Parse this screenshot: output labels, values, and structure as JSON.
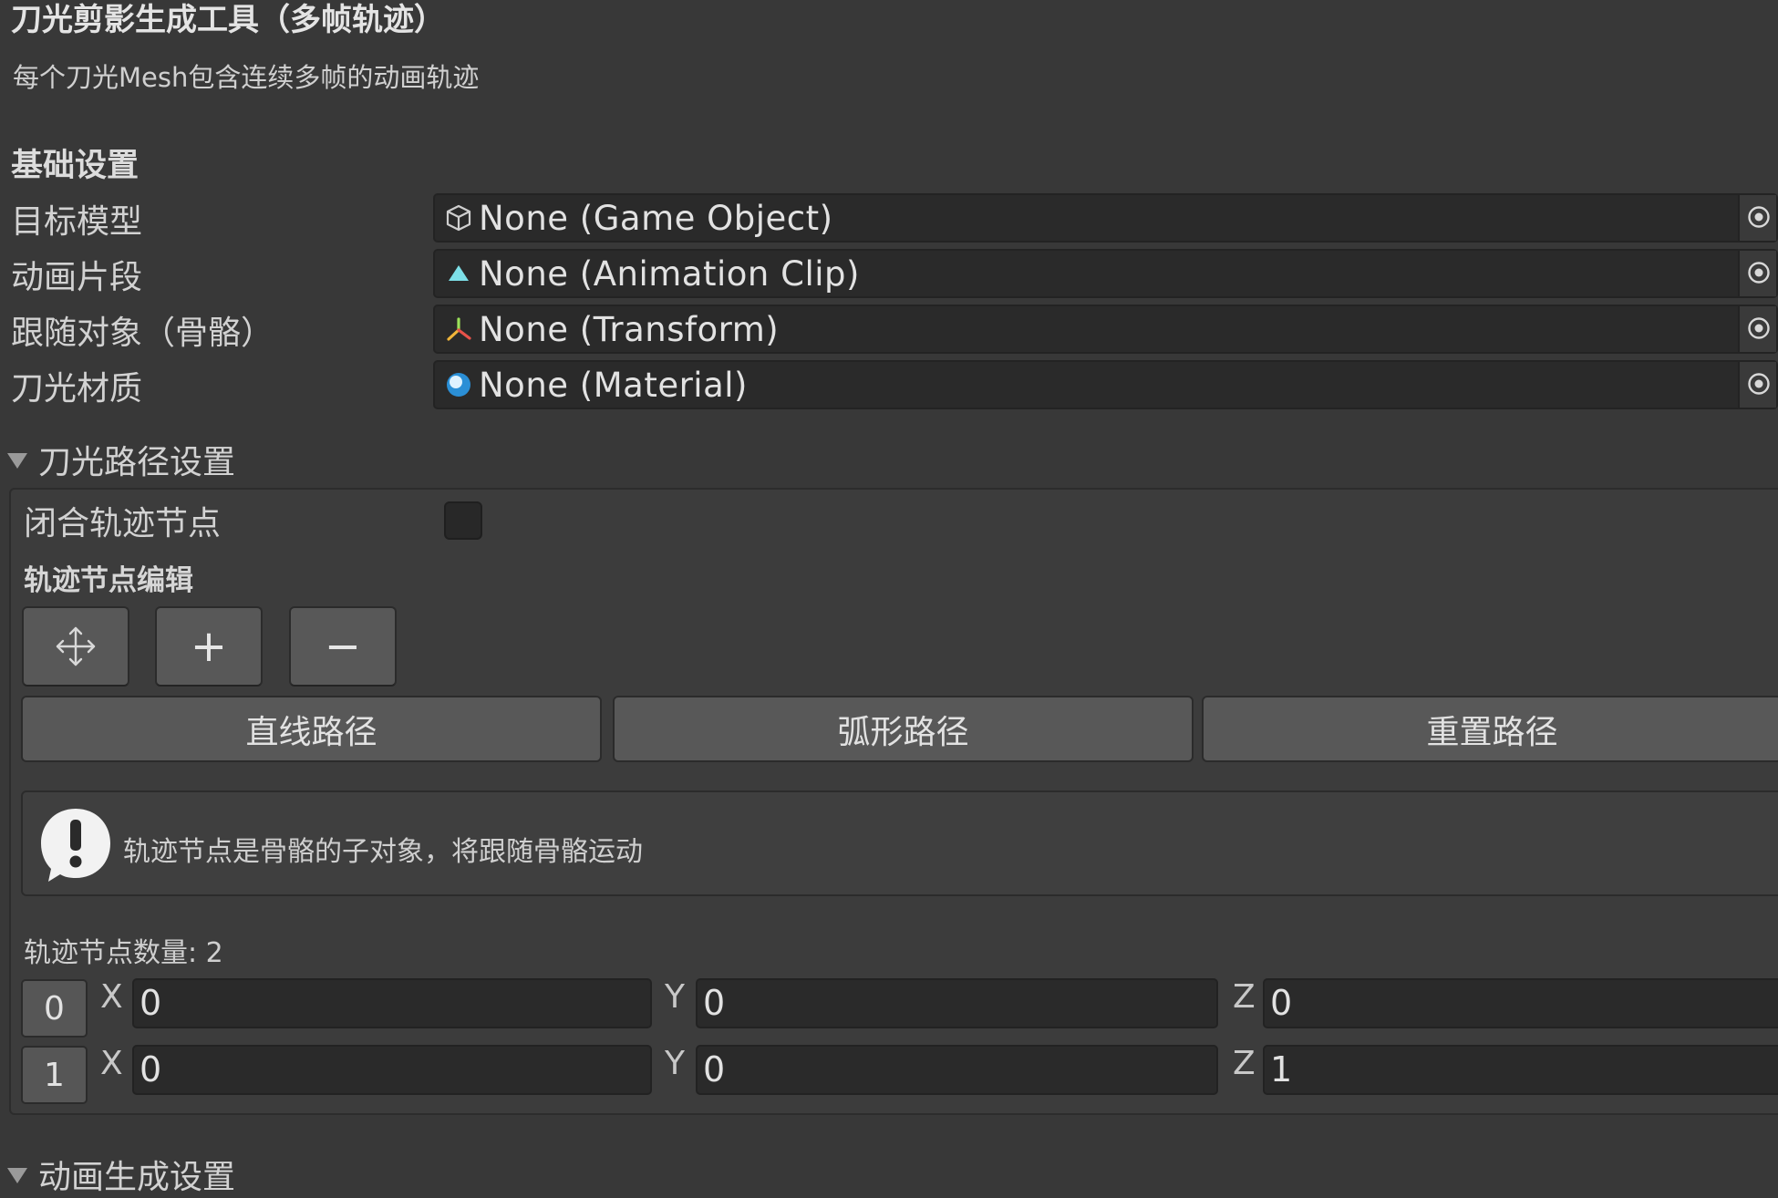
{
  "header": {
    "title": "刀光剪影生成工具（多帧轨迹）",
    "subtitle": "每个刀光Mesh包含连续多帧的动画轨迹"
  },
  "basic_settings": {
    "heading": "基础设置",
    "fields": [
      {
        "label": "目标模型",
        "value": "None (Game Object)",
        "icon": "gameobject-cube-icon"
      },
      {
        "label": "动画片段",
        "value": "None (Animation Clip)",
        "icon": "animation-clip-icon"
      },
      {
        "label": "跟随对象（骨骼）",
        "value": "None (Transform)",
        "icon": "transform-axes-icon"
      },
      {
        "label": "刀光材质",
        "value": "None (Material)",
        "icon": "material-sphere-icon"
      }
    ]
  },
  "path_settings": {
    "foldout_label": "刀光路径设置",
    "closed_label": "闭合轨迹节点",
    "closed_checked": false,
    "edit_heading": "轨迹节点编辑",
    "tool_buttons": {
      "move": "move-tool-icon",
      "add": "+",
      "remove": "−"
    },
    "path_buttons": [
      "直线路径",
      "弧形路径",
      "重置路径"
    ],
    "help_text": "轨迹节点是骨骼的子对象，将跟随骨骼运动",
    "node_count_label": "轨迹节点数量: 2",
    "nodes": [
      {
        "index": "0",
        "x": "0",
        "y": "0",
        "z": "0"
      },
      {
        "index": "1",
        "x": "0",
        "y": "0",
        "z": "1"
      }
    ],
    "axis_labels": {
      "x": "X",
      "y": "Y",
      "z": "Z"
    }
  },
  "animation_settings": {
    "foldout_label": "动画生成设置"
  }
}
